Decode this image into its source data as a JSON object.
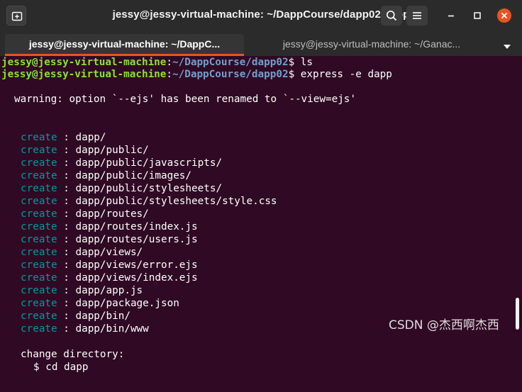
{
  "window": {
    "title": "jessy@jessy-virtual-machine: ~/DappCourse/dapp02/dapp"
  },
  "tabs": [
    {
      "label": "jessy@jessy-virtual-machine: ~/DappC...",
      "active": true
    },
    {
      "label": "jessy@jessy-virtual-machine: ~/Ganac...",
      "active": false
    }
  ],
  "icons": {
    "new_tab": "new-tab-icon",
    "search": "search-icon",
    "menu": "hamburger-menu-icon",
    "minimize": "minimize-icon",
    "maximize": "maximize-icon",
    "close": "close-icon",
    "tab_menu": "chevron-down-icon"
  },
  "colors": {
    "terminal_bg": "#300a24",
    "titlebar_bg": "#2b2b2b",
    "accent": "#e95420",
    "prompt_user": "#8ae234",
    "prompt_path": "#729fcf",
    "create_keyword": "#06989a"
  },
  "terminal": {
    "prompt1": {
      "user": "jessy@jessy-virtual-machine",
      "sep": ":",
      "path": "~/DappCourse/dapp02",
      "sym": "$ ",
      "cmd": "ls"
    },
    "prompt2": {
      "user": "jessy@jessy-virtual-machine",
      "sep": ":",
      "path": "~/DappCourse/dapp02",
      "sym": "$ ",
      "cmd": "express -e dapp"
    },
    "warning": "warning: option `--ejs' has been renamed to `--view=ejs'",
    "create_keyword": "create",
    "create_sep": " : ",
    "created": [
      "dapp/",
      "dapp/public/",
      "dapp/public/javascripts/",
      "dapp/public/images/",
      "dapp/public/stylesheets/",
      "dapp/public/stylesheets/style.css",
      "dapp/routes/",
      "dapp/routes/index.js",
      "dapp/routes/users.js",
      "dapp/views/",
      "dapp/views/error.ejs",
      "dapp/views/index.ejs",
      "dapp/app.js",
      "dapp/package.json",
      "dapp/bin/",
      "dapp/bin/www"
    ],
    "change_dir_label": "change directory:",
    "change_dir_cmd": "$ cd dapp"
  },
  "watermark": "CSDN @杰西啊杰西"
}
